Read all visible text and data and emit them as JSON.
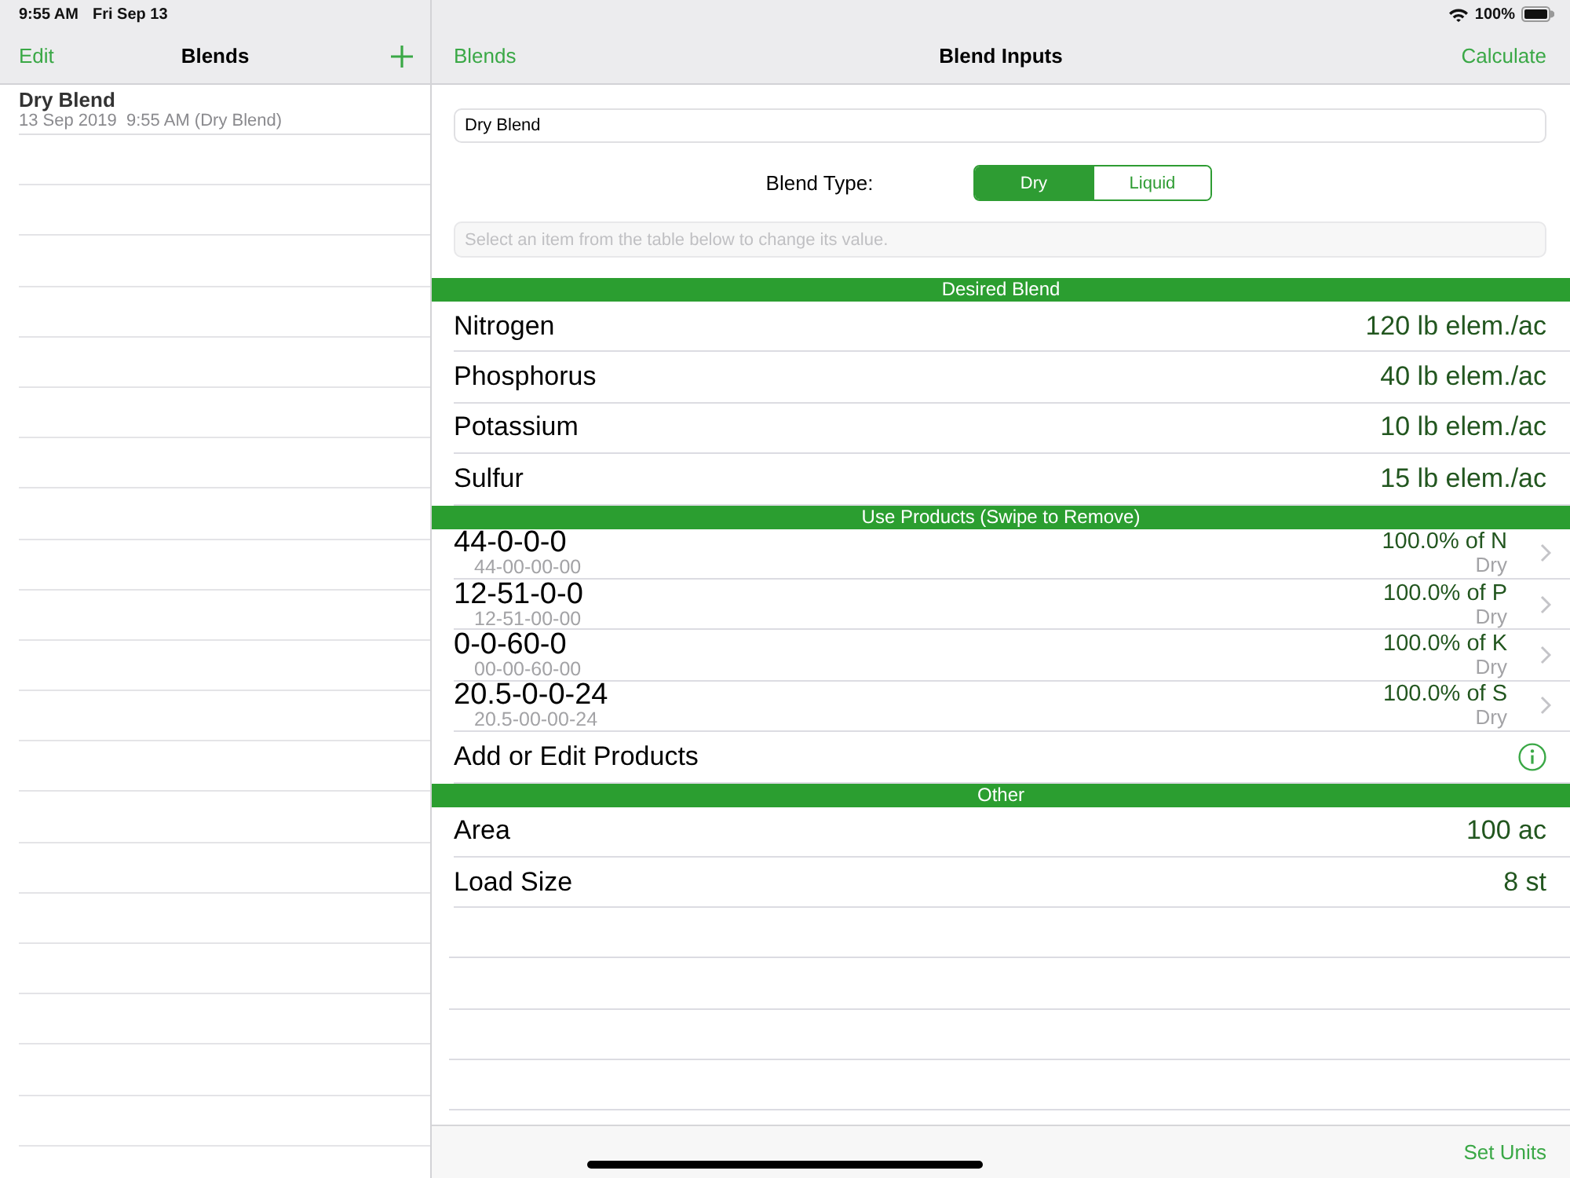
{
  "status_bar": {
    "time": "9:55 AM",
    "date": "Fri Sep 13",
    "battery": "100%"
  },
  "sidebar": {
    "nav": {
      "edit": "Edit",
      "title": "Blends"
    },
    "items": [
      {
        "title": "Dry Blend",
        "subtitle": "13 Sep 2019  9:55 AM (Dry Blend)",
        "selected": false
      }
    ]
  },
  "detail": {
    "nav": {
      "back": "Blends",
      "title": "Blend Inputs",
      "action": "Calculate"
    },
    "name_field": {
      "value": "Dry Blend"
    },
    "blend_type": {
      "label": "Blend Type:",
      "options": [
        {
          "label": "Dry",
          "selected": true
        },
        {
          "label": "Liquid",
          "selected": false
        }
      ]
    },
    "hint_field": {
      "placeholder": "Select an item from the table below to change its value."
    },
    "sections": [
      {
        "header": "Desired Blend",
        "rows": [
          {
            "kind": "value",
            "label": "Nitrogen",
            "value": "120 lb elem./ac"
          },
          {
            "kind": "value",
            "label": "Phosphorus",
            "value": "40 lb elem./ac"
          },
          {
            "kind": "value",
            "label": "Potassium",
            "value": "10 lb elem./ac"
          },
          {
            "kind": "value",
            "label": "Sulfur",
            "value": "15 lb elem./ac"
          }
        ]
      },
      {
        "header": "Use Products (Swipe to Remove)",
        "rows": [
          {
            "kind": "product",
            "label": "44-0-0-0",
            "code": "44-00-00-00",
            "share": "100.0% of N",
            "form": "Dry"
          },
          {
            "kind": "product",
            "label": "12-51-0-0",
            "code": "12-51-00-00",
            "share": "100.0% of P",
            "form": "Dry"
          },
          {
            "kind": "product",
            "label": "0-0-60-0",
            "code": "00-00-60-00",
            "share": "100.0% of K",
            "form": "Dry"
          },
          {
            "kind": "product",
            "label": "20.5-0-0-24",
            "code": "20.5-00-00-24",
            "share": "100.0% of S",
            "form": "Dry"
          },
          {
            "kind": "action",
            "label": "Add or Edit Products"
          }
        ]
      },
      {
        "header": "Other",
        "rows": [
          {
            "kind": "value",
            "label": "Area",
            "value": "100 ac"
          },
          {
            "kind": "value",
            "label": "Load Size",
            "value": "8 st"
          }
        ]
      }
    ]
  },
  "toolbar": {
    "action": "Set Units"
  }
}
